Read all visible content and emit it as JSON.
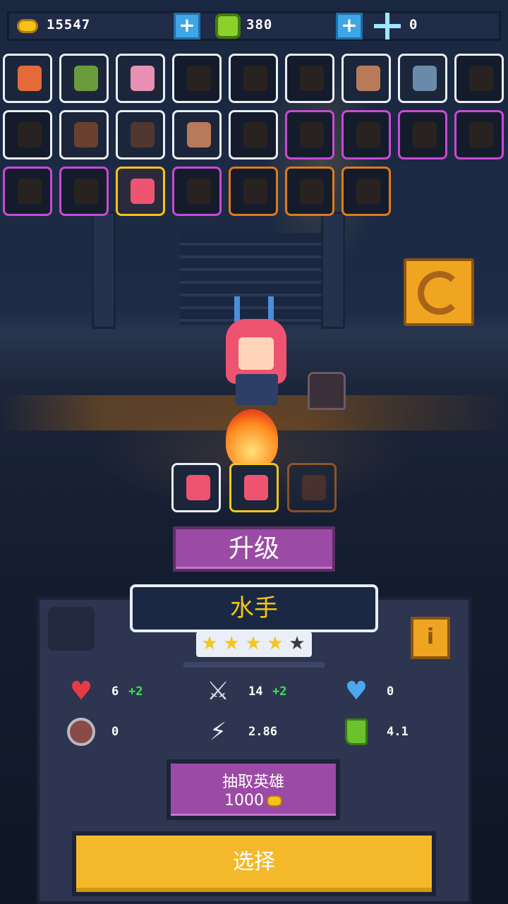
{
  "resources": {
    "gold": "15547",
    "gems": "380",
    "crystals": "0"
  },
  "hero_grid": {
    "rows": [
      [
        "white",
        "white",
        "white",
        "white-locked",
        "white-locked",
        "white-locked",
        "white",
        "white",
        "white-locked"
      ],
      [
        "white-locked",
        "white",
        "white",
        "white",
        "white-locked",
        "purple-locked",
        "purple-locked",
        "purple-locked",
        "purple-locked"
      ],
      [
        "purple-locked",
        "purple-locked",
        "gold",
        "purple-locked",
        "orange-locked",
        "orange-locked",
        "orange-locked"
      ]
    ]
  },
  "hero": {
    "name": "水手",
    "stars_filled": 4,
    "stars_total": 5
  },
  "buttons": {
    "upgrade": "升级",
    "draw_hero": "抽取英雄",
    "draw_cost": "1000",
    "select": "选择"
  },
  "stats": {
    "health": "6",
    "health_bonus": "+2",
    "attack": "14",
    "attack_bonus": "+2",
    "shield": "0",
    "armor": "0",
    "attack_speed": "2.86",
    "move_speed": "4.1"
  },
  "colors": {
    "gold": "#f5c518",
    "purple_button": "#9b4aa5",
    "select_button": "#f3b92a",
    "bonus_green": "#3fe05a"
  }
}
